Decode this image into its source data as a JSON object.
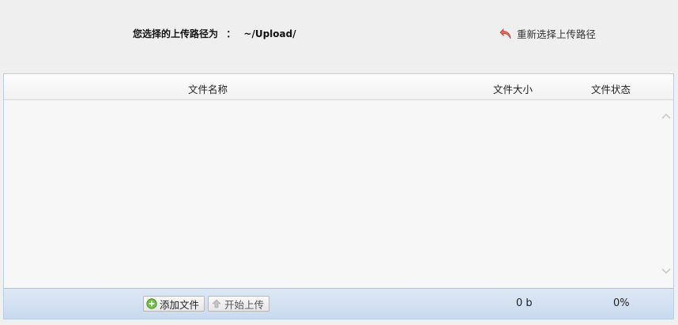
{
  "header": {
    "path_label": "您选择的上传路径为",
    "separator": "：",
    "path_value": "~/Upload/",
    "reselect_label": "重新选择上传路径"
  },
  "grid": {
    "columns": {
      "name": "文件名称",
      "size": "文件大小",
      "status": "文件状态"
    },
    "rows": []
  },
  "footer": {
    "add_button": "添加文件",
    "start_button": "开始上传",
    "total_size": "0 b",
    "total_percent": "0%"
  },
  "colors": {
    "panel_border": "#b9cfe6",
    "footer_bg": "#c9daee",
    "add_icon": "#5aa832",
    "reselect_icon": "#d9534f"
  }
}
